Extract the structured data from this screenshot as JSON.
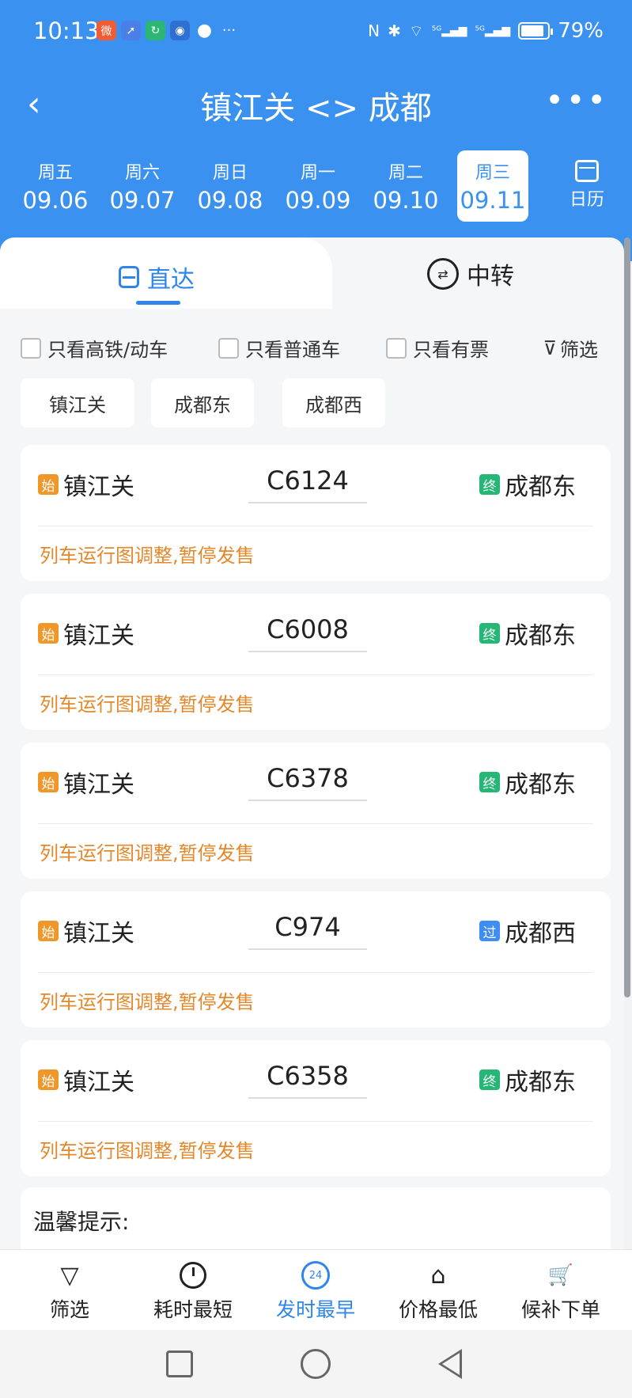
{
  "status_bar": {
    "time": "10:13",
    "battery_percent": "79%",
    "battery_level": 0.79,
    "icons": [
      "weibo-icon",
      "compass-icon",
      "refresh-app-icon",
      "app-icon",
      "message-icon",
      "more-dots-icon",
      "nfc-icon",
      "bluetooth-icon",
      "wifi-icon",
      "signal-5g-icon",
      "signal-5g-icon",
      "battery-icon"
    ],
    "more": "···",
    "nfc": "N",
    "bt": "✱",
    "wifi": "⌔",
    "sig1": "⁵ᴳ▂▄▆",
    "sig2": "⁵ᴳ▂▄▆"
  },
  "navbar": {
    "back": "‹",
    "title": "镇江关 <> 成都",
    "more": "•••"
  },
  "dates": [
    {
      "weekday": "周五",
      "date": "09.06"
    },
    {
      "weekday": "周六",
      "date": "09.07"
    },
    {
      "weekday": "周日",
      "date": "09.08"
    },
    {
      "weekday": "周一",
      "date": "09.09"
    },
    {
      "weekday": "周二",
      "date": "09.10"
    },
    {
      "weekday": "周三",
      "date": "09.11"
    }
  ],
  "calendar_label": "日历",
  "tabs": {
    "direct": "直达",
    "transfer": "中转"
  },
  "filters": {
    "high_speed": "只看高铁/动车",
    "regular": "只看普通车",
    "available": "只看有票",
    "filter_link": "筛选",
    "filter_icon": "⊽"
  },
  "station_chips": [
    "镇江关",
    "成都东",
    "成都西"
  ],
  "trains": [
    {
      "from_badge": "始",
      "from": "镇江关",
      "train": "C6124",
      "to_badge": "终",
      "to": "成都东",
      "note": "列车运行图调整,暂停发售"
    },
    {
      "from_badge": "始",
      "from": "镇江关",
      "train": "C6008",
      "to_badge": "终",
      "to": "成都东",
      "note": "列车运行图调整,暂停发售"
    },
    {
      "from_badge": "始",
      "from": "镇江关",
      "train": "C6378",
      "to_badge": "终",
      "to": "成都东",
      "note": "列车运行图调整,暂停发售"
    },
    {
      "from_badge": "始",
      "from": "镇江关",
      "train": "C974",
      "to_badge": "过",
      "to": "成都西",
      "note": "列车运行图调整,暂停发售"
    },
    {
      "from_badge": "始",
      "from": "镇江关",
      "train": "C6358",
      "to_badge": "终",
      "to": "成都东",
      "note": "列车运行图调整,暂停发售"
    }
  ],
  "tips_title": "温馨提示:",
  "toolbar": {
    "filter": "筛选",
    "shortest": "耗时最短",
    "earliest": "发时最早",
    "earliest_icon": "24",
    "lowest_price": "价格最低",
    "waitlist": "候补下单",
    "filter_icon": "▽",
    "price_icon": "⌂",
    "cart_icon": "🛒"
  },
  "colors": {
    "primary_blue": "#3a91f0",
    "active_blue": "#2f86ea",
    "start_badge": "#f0972a",
    "end_badge": "#26b777",
    "pass_badge": "#3d8ef0",
    "notice_orange": "#e4882b"
  }
}
